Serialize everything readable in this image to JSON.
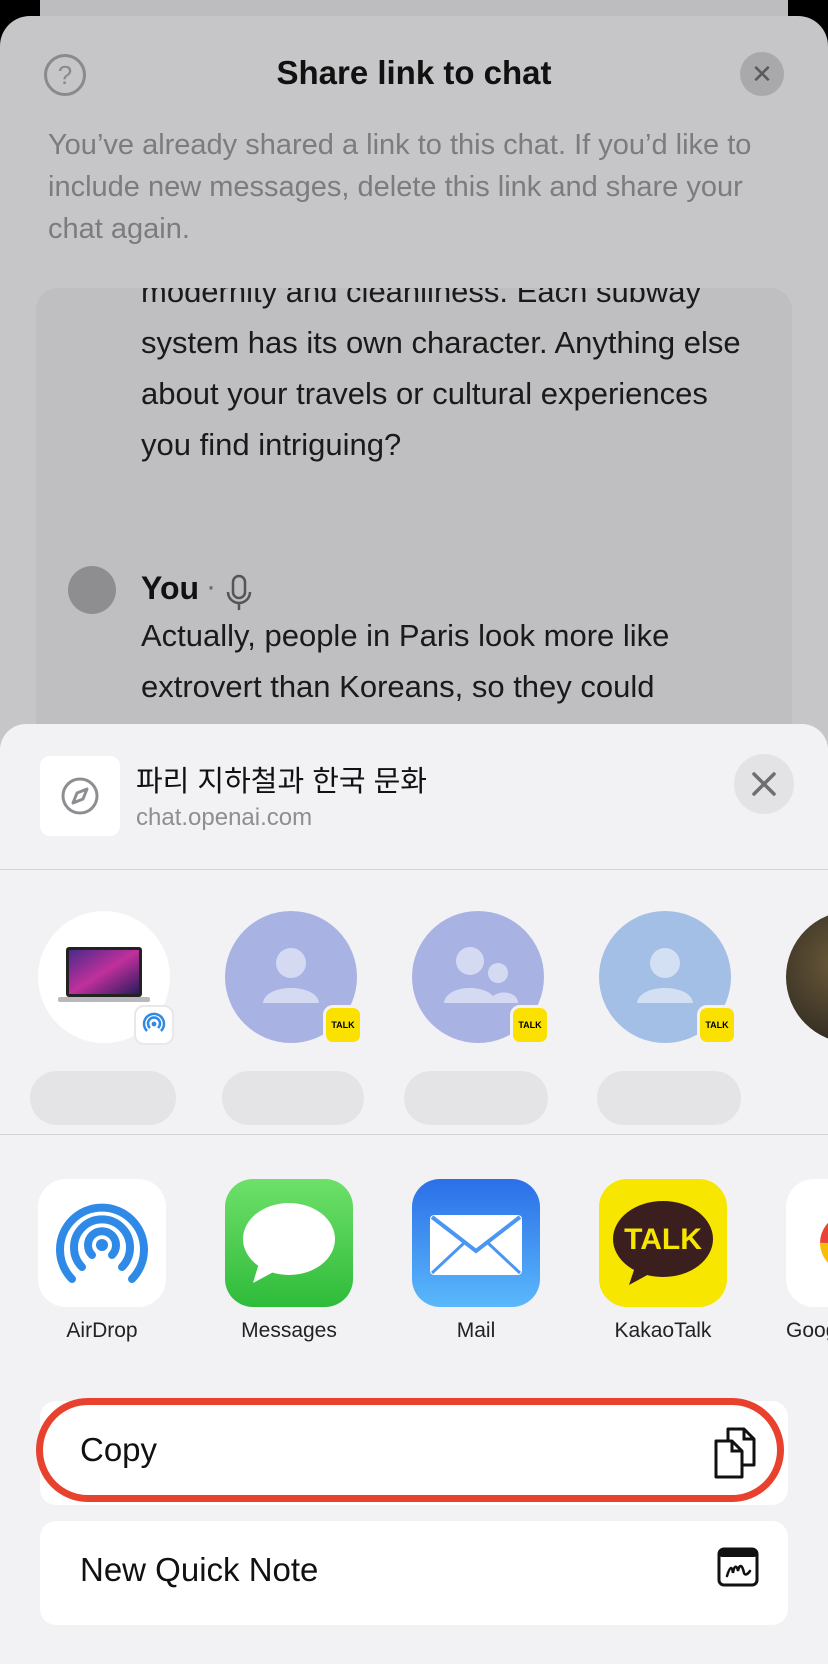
{
  "modal": {
    "help_icon_glyph": "?",
    "title": "Share link to chat",
    "close_glyph": "✕",
    "description": "You’ve already shared a link to this chat. If you’d like to include new messages, delete this link and share your chat again.",
    "chat": {
      "cut_line": "modernity and cleanliness. Each",
      "assistant_text": "subway system has its own character. Anything else about your travels or cultural experiences you find intriguing?",
      "user_author": "You",
      "separator": "·",
      "user_text": "Actually, people in Paris look more like extrovert than Koreans, so they could"
    }
  },
  "share_sheet": {
    "link_title": "파리 지하철과 한국 문화",
    "link_url": "chat.openai.com",
    "close_glyph": "✕",
    "people": [
      {
        "type": "airdrop-device",
        "badge": "airdrop"
      },
      {
        "type": "contact",
        "badge": "TALK"
      },
      {
        "type": "group",
        "badge": "TALK"
      },
      {
        "type": "contact",
        "badge": "TALK"
      },
      {
        "type": "photo"
      }
    ],
    "apps": [
      {
        "label": "AirDrop",
        "icon": "airdrop-icon"
      },
      {
        "label": "Messages",
        "icon": "messages-icon"
      },
      {
        "label": "Mail",
        "icon": "mail-icon"
      },
      {
        "label": "KakaoTalk",
        "icon": "kakaotalk-icon",
        "icon_text": "TALK"
      },
      {
        "label": "Goog",
        "icon": "google-icon"
      }
    ],
    "actions": [
      {
        "label": "Copy",
        "icon": "copy-icon"
      },
      {
        "label": "New Quick Note",
        "icon": "quick-note-icon"
      }
    ]
  },
  "colors": {
    "highlight": "#e8412e",
    "kakao_yellow": "#fae100",
    "messages_green": "#34c759",
    "mail_blue": "#2f8cf4",
    "airdrop_blue": "#2e8ae6"
  }
}
